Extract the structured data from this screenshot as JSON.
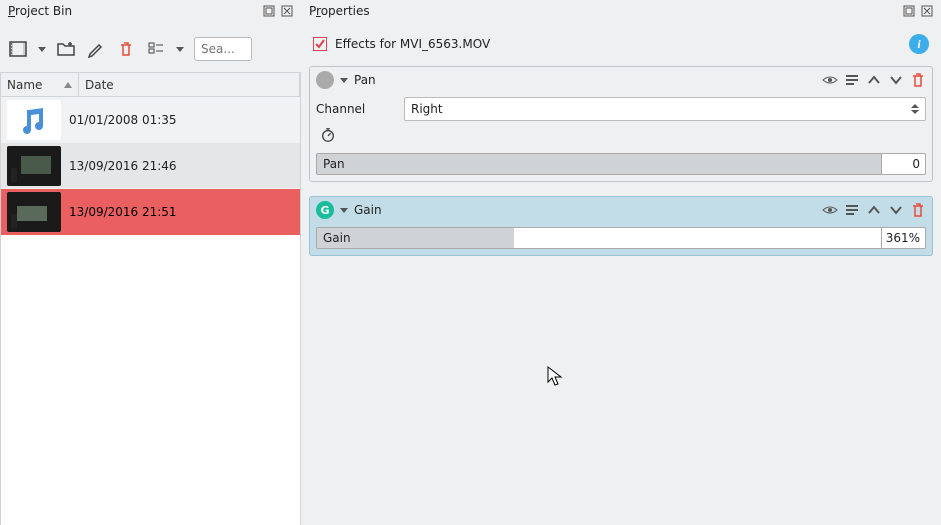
{
  "panels": {
    "left_title": "Project Bin",
    "right_title": "Properties"
  },
  "bin": {
    "search_placeholder": "Sea...",
    "columns": {
      "name": "Name",
      "date": "Date"
    },
    "rows": [
      {
        "date": "01/01/2008 01:35",
        "kind": "music"
      },
      {
        "date": "13/09/2016 21:46",
        "kind": "video1"
      },
      {
        "date": "13/09/2016 21:51",
        "kind": "video2"
      }
    ]
  },
  "effects": {
    "header": "Effects for MVI_6563.MOV",
    "pan": {
      "name": "Pan",
      "channel_label": "Channel",
      "channel_value": "Right",
      "slider_label": "Pan",
      "slider_value": "0"
    },
    "gain": {
      "name": "Gain",
      "icon_letter": "G",
      "slider_label": "Gain",
      "slider_value": "361%"
    }
  }
}
